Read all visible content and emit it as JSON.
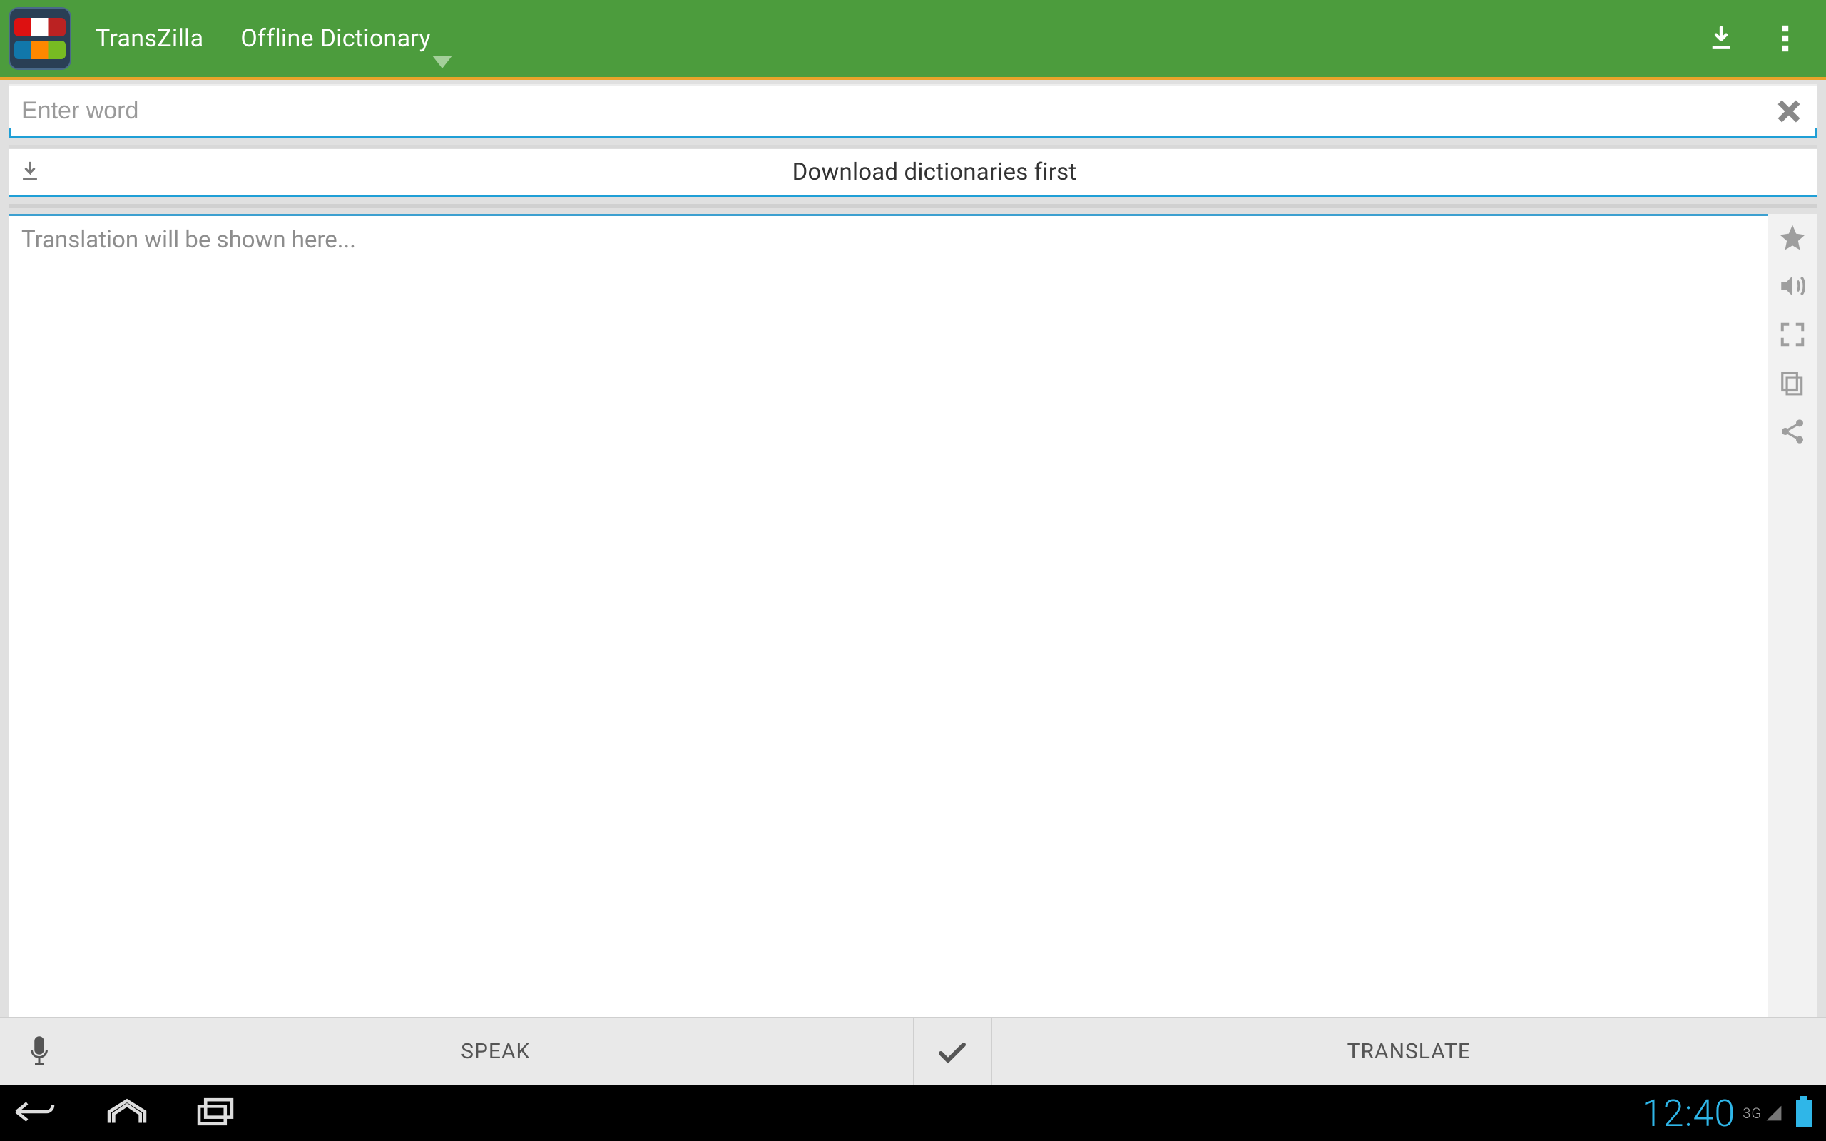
{
  "header": {
    "tabs": [
      "TransZilla",
      "Offline Dictionary"
    ],
    "active_tab": 1
  },
  "input": {
    "placeholder": "Enter word",
    "value": ""
  },
  "dictionary_bar": {
    "status": "Download dictionaries first"
  },
  "result": {
    "placeholder": "Translation will be shown here..."
  },
  "bottom": {
    "speak_label": "SPEAK",
    "translate_label": "TRANSLATE"
  },
  "statusbar": {
    "time": "12:40",
    "network": "3G"
  }
}
